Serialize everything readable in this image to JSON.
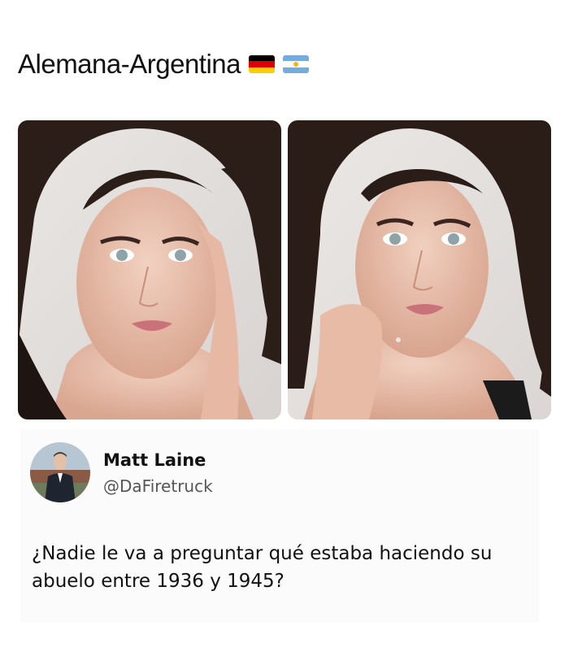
{
  "post": {
    "title": "Alemana-Argentina",
    "flags": [
      "germany-flag-icon",
      "argentina-flag-icon"
    ]
  },
  "photos": [
    {
      "name": "selfie-left",
      "alt": "woman-portrait-hand-on-cheek"
    },
    {
      "name": "selfie-right",
      "alt": "woman-portrait-hand-on-neck"
    }
  ],
  "tweet": {
    "author_name": "Matt Laine",
    "author_handle": "@DaFiretruck",
    "text": "¿Nadie le va a preguntar qué estaba haciendo su abuelo entre 1936 y 1945?"
  },
  "colors": {
    "de_black": "#000000",
    "de_red": "#DD0000",
    "de_gold": "#FFCE00",
    "ar_blue": "#74ACDF",
    "ar_white": "#FFFFFF",
    "ar_sun": "#F6B40E"
  }
}
